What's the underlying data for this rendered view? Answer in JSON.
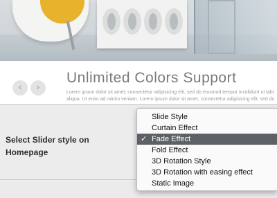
{
  "slider": {
    "title": "Unlimited Colors Support",
    "text": [
      "Lorem ipsum dolor sit amet, consectetur adipisicing elit, sed do eiusmod tempor incididunt ut labore et dolore magna",
      "aliqua. Ut enim ad minim veniam. Lorem ipsum dolor sit amet, consectetur adipisicing elit, sed do.Lorem ipsum dolor"
    ],
    "prev_icon": "‹",
    "next_icon": "›"
  },
  "setting": {
    "label_line1": "Select Slider style on",
    "label_line2": "Homepage"
  },
  "dropdown": {
    "check_mark": "✓",
    "options": [
      {
        "label": "Slide Style",
        "selected": false
      },
      {
        "label": "Curtain Effect",
        "selected": false
      },
      {
        "label": "Fade Effect",
        "selected": true
      },
      {
        "label": "Fold Effect",
        "selected": false
      },
      {
        "label": "3D Rotation Style",
        "selected": false
      },
      {
        "label": "3D Rotation with easing effect",
        "selected": false
      },
      {
        "label": "Static Image",
        "selected": false
      }
    ]
  }
}
